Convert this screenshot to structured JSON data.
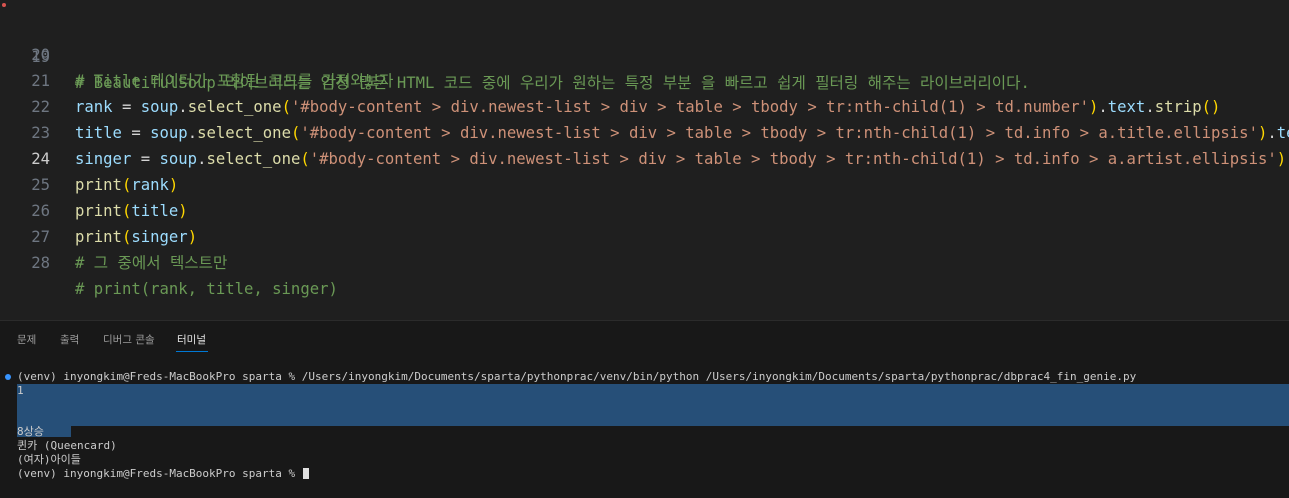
{
  "editor": {
    "lines": [
      {
        "num": "19",
        "comment": "# BeautifulSoup 라이브러리는 엄청 많은 HTML 코드 중에 우리가 원하는 특정 부분 을 빠르고 쉽게 필터링 해주는 라이브러리이다."
      },
      {
        "num": "20",
        "comment": "# Title 데이터가 포함된 코드를 가져와보자"
      },
      {
        "num": "21",
        "var": "rank",
        "selector": "'#body-content > div.newest-list > div > table > tbody > tr:nth-child(1) > td.number'"
      },
      {
        "num": "22",
        "var": "title",
        "selector": "'#body-content > div.newest-list > div > table > tbody > tr:nth-child(1) > td.info > a.title.ellipsis'"
      },
      {
        "num": "23",
        "var": "singer",
        "selector": "'#body-content > div.newest-list > div > table > tbody > tr:nth-child(1) > td.info > a.artist.ellipsis'"
      },
      {
        "num": "24",
        "fn": "print",
        "arg": "rank"
      },
      {
        "num": "25",
        "fn": "print",
        "arg": "title"
      },
      {
        "num": "26",
        "fn": "print",
        "arg": "singer"
      },
      {
        "num": "27",
        "comment": "# 그 중에서 텍스트만"
      },
      {
        "num": "28",
        "comment": "# print(rank, title, singer)"
      }
    ],
    "tokens": {
      "eq": " = ",
      "soup": "soup",
      "dot": ".",
      "select_one": "select_one",
      "open": "(",
      "close": ")",
      "text": "text",
      "strip": "strip",
      "call": "()"
    }
  },
  "panel": {
    "tabs": [
      "문제",
      "출력",
      "디버그 콘솔",
      "터미널"
    ],
    "active_tab": "터미널"
  },
  "terminal": {
    "command": "(venv) inyongkim@Freds-MacBookPro sparta % /Users/inyongkim/Documents/sparta/pythonprac/venv/bin/python /Users/inyongkim/Documents/sparta/pythonprac/dbprac4_fin_genie.py",
    "output": [
      "1",
      "",
      "",
      "8상승",
      "퀸카 (Queencard)",
      "(여자)아이들"
    ],
    "prompt": "(venv) inyongkim@Freds-MacBookPro sparta % "
  },
  "colors": {
    "accent": "#0078d4",
    "selection": "#264f78",
    "comment": "#6a9955",
    "string": "#ce9178",
    "function": "#dcdcaa",
    "variable": "#9cdcfe"
  }
}
